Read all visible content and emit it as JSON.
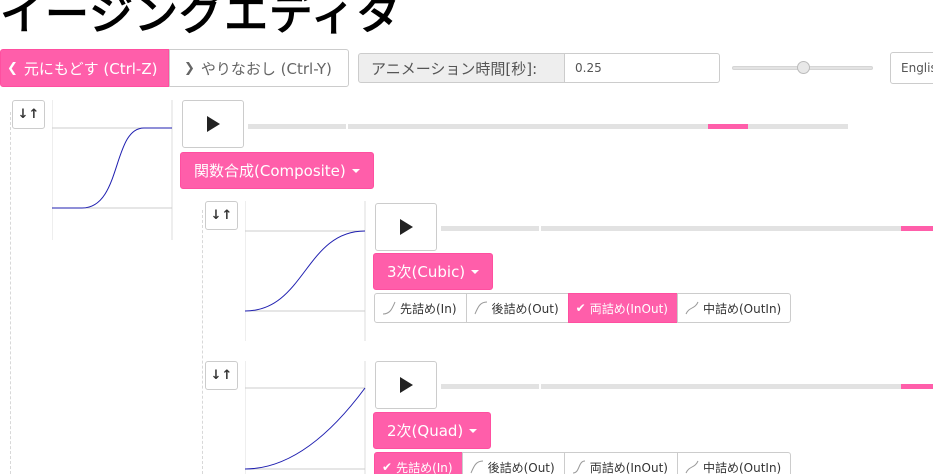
{
  "header": {
    "title": "イージングエディタ"
  },
  "toolbar": {
    "undo_label": "元にもどす (Ctrl-Z)",
    "redo_label": "やりなおし (Ctrl-Y)",
    "duration_label": "アニメーション時間[秒]:",
    "duration_value": "0.25",
    "duration_slider_fraction": 0.5,
    "language_value": "English"
  },
  "root": {
    "reverse_icon": "sort-arrows-icon",
    "play_icon": "play-icon",
    "type_label": "関数合成(Composite)",
    "track_marker_fraction": 0.8
  },
  "children": [
    {
      "type_label": "3次(Cubic)",
      "modes": [
        "先詰め(In)",
        "後詰め(Out)",
        "両詰め(InOut)",
        "中詰め(OutIn)"
      ],
      "active_mode": "両詰め(InOut)"
    },
    {
      "type_label": "2次(Quad)",
      "modes": [
        "先詰め(In)",
        "後詰め(Out)",
        "両詰め(InOut)",
        "中詰め(OutIn)"
      ],
      "active_mode": "先詰め(In)"
    }
  ],
  "colors": {
    "accent": "#ff5eaa",
    "curve": "#1f1fb0"
  }
}
